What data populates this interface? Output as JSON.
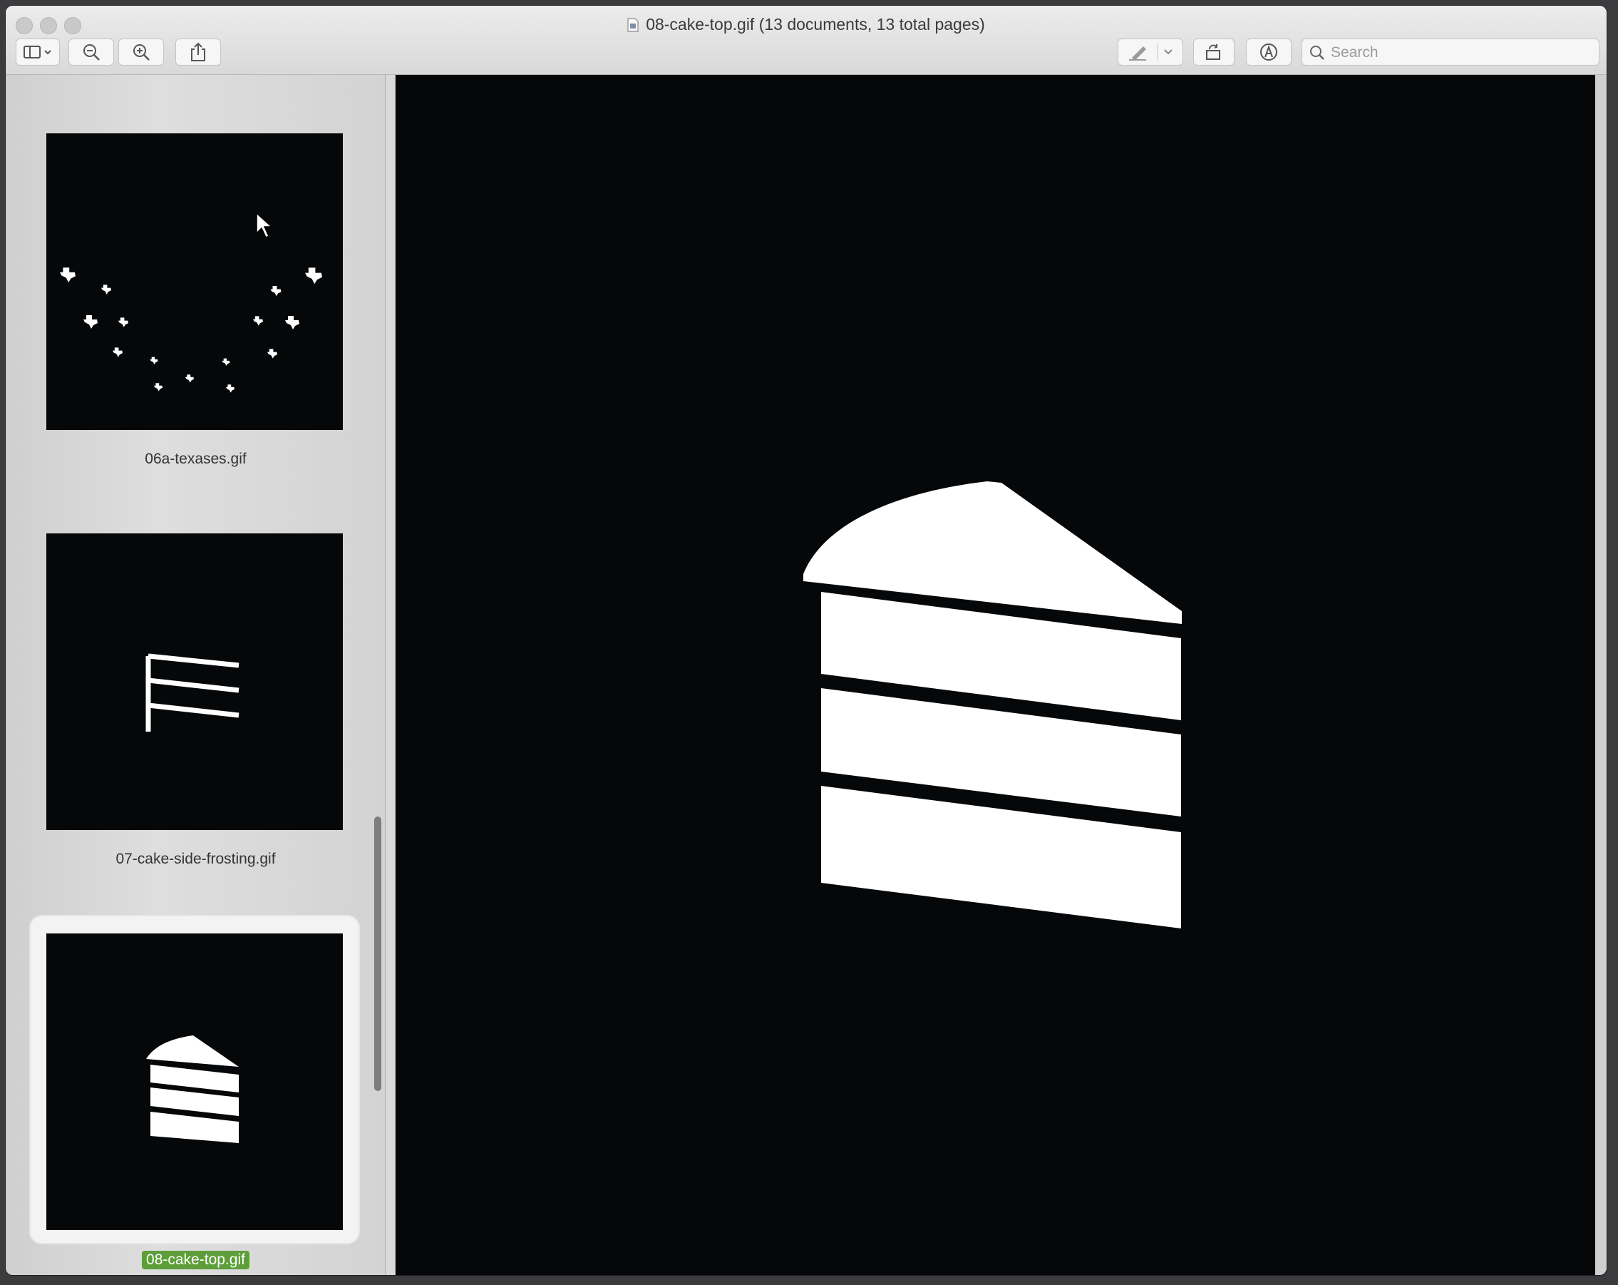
{
  "window": {
    "title": "08-cake-top.gif (13 documents, 13 total pages)"
  },
  "toolbar": {
    "sidebar_toggle": "sidebar-toggle",
    "zoom_out": "zoom-out",
    "zoom_in": "zoom-in",
    "share": "share",
    "markup": "markup-pen",
    "rotate": "rotate",
    "annotate": "markup-toolbar",
    "search": {
      "placeholder": "Search",
      "value": ""
    }
  },
  "sidebar": {
    "items": [
      {
        "label": "06a-texases.gif",
        "selected": false,
        "image": "texas-shapes"
      },
      {
        "label": "07-cake-side-frosting.gif",
        "selected": false,
        "image": "frosting-lines"
      },
      {
        "label": "08-cake-top.gif",
        "selected": true,
        "image": "cake-slice"
      }
    ]
  },
  "viewer": {
    "image": "cake-slice",
    "background": "#050709",
    "foreground": "#ffffff"
  },
  "colors": {
    "selection": "#5e9e3a",
    "window_chrome": "#e8e8e8"
  }
}
